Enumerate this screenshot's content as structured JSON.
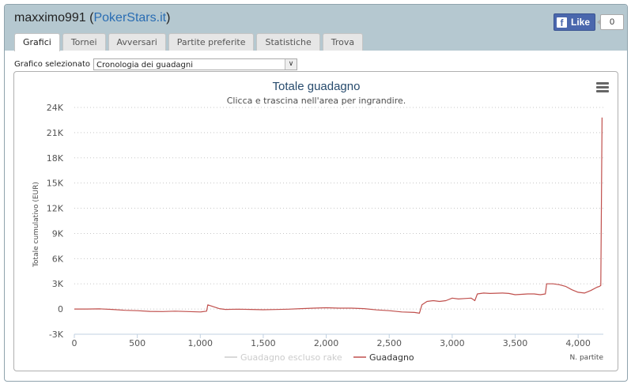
{
  "window": {
    "user": "maxximo991",
    "site_link": "PokerStars.it",
    "facebook": {
      "label": "Like",
      "count": "0"
    }
  },
  "tabs": [
    "Grafici",
    "Tornei",
    "Avversari",
    "Partite preferite",
    "Statistiche",
    "Trova"
  ],
  "active_tab": "Grafici",
  "chart_selector": {
    "label": "Grafico selezionato",
    "value": "Cronologia dei guadagni"
  },
  "chart_data": {
    "type": "line",
    "title": "Totale guadagno",
    "subtitle": "Clicca e trascina nell'area per ingrandire.",
    "ylabel": "Totale cumulativo (EUR)",
    "xlabel": "N. partite",
    "xlim": [
      0,
      4200
    ],
    "ylim": [
      -3000,
      24000
    ],
    "x_ticks": [
      "0",
      "500",
      "1,000",
      "1,500",
      "2,000",
      "2,500",
      "3,000",
      "3,500",
      "4,000"
    ],
    "y_ticks": [
      "-3K",
      "0",
      "3K",
      "6K",
      "9K",
      "12K",
      "15K",
      "18K",
      "21K",
      "24K"
    ],
    "grid": "horizontal dotted",
    "legend_position": "bottom",
    "series": [
      {
        "name": "Guadagno escluso rake",
        "color": "#cccccc",
        "values": []
      },
      {
        "name": "Guadagno",
        "color": "#c0504d",
        "points": [
          [
            0,
            0
          ],
          [
            100,
            0
          ],
          [
            200,
            20
          ],
          [
            300,
            -50
          ],
          [
            400,
            -150
          ],
          [
            500,
            -200
          ],
          [
            600,
            -280
          ],
          [
            700,
            -300
          ],
          [
            800,
            -250
          ],
          [
            900,
            -300
          ],
          [
            1000,
            -350
          ],
          [
            1050,
            -250
          ],
          [
            1060,
            500
          ],
          [
            1100,
            300
          ],
          [
            1150,
            50
          ],
          [
            1200,
            -50
          ],
          [
            1300,
            -20
          ],
          [
            1400,
            -50
          ],
          [
            1500,
            -80
          ],
          [
            1600,
            -60
          ],
          [
            1700,
            -20
          ],
          [
            1800,
            50
          ],
          [
            1900,
            100
          ],
          [
            2000,
            150
          ],
          [
            2100,
            100
          ],
          [
            2200,
            100
          ],
          [
            2300,
            50
          ],
          [
            2400,
            -100
          ],
          [
            2500,
            -200
          ],
          [
            2600,
            -350
          ],
          [
            2700,
            -400
          ],
          [
            2740,
            -500
          ],
          [
            2760,
            500
          ],
          [
            2800,
            900
          ],
          [
            2850,
            1000
          ],
          [
            2900,
            900
          ],
          [
            2950,
            1000
          ],
          [
            3000,
            1300
          ],
          [
            3050,
            1200
          ],
          [
            3100,
            1250
          ],
          [
            3150,
            1300
          ],
          [
            3180,
            1000
          ],
          [
            3200,
            1800
          ],
          [
            3250,
            1900
          ],
          [
            3300,
            1850
          ],
          [
            3400,
            1900
          ],
          [
            3450,
            1850
          ],
          [
            3500,
            1700
          ],
          [
            3600,
            1800
          ],
          [
            3650,
            1800
          ],
          [
            3700,
            1700
          ],
          [
            3740,
            1800
          ],
          [
            3750,
            3000
          ],
          [
            3800,
            3000
          ],
          [
            3850,
            2900
          ],
          [
            3900,
            2700
          ],
          [
            3950,
            2300
          ],
          [
            4000,
            2000
          ],
          [
            4050,
            1900
          ],
          [
            4100,
            2200
          ],
          [
            4150,
            2600
          ],
          [
            4170,
            2700
          ],
          [
            4180,
            2800
          ],
          [
            4190,
            22800
          ]
        ]
      }
    ]
  }
}
